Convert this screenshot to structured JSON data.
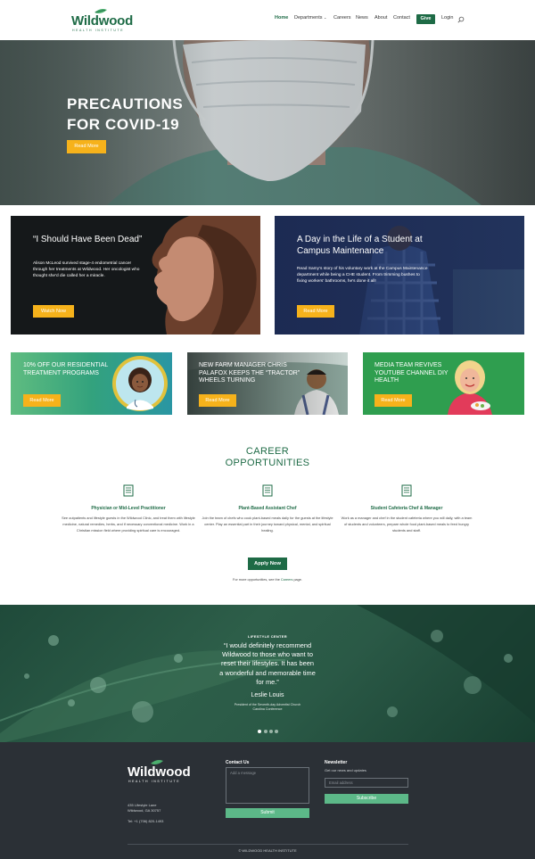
{
  "header": {
    "logo_text": "Wildwood",
    "logo_sub": "HEALTH INSTITUTE",
    "nav": [
      "Home",
      "Departments",
      "Careers",
      "News",
      "About",
      "Contact"
    ],
    "give_label": "Give",
    "login_label": "Login"
  },
  "hero": {
    "title_line1": "PRECAUTIONS",
    "title_line2": "FOR COVID-19",
    "button": "Read More"
  },
  "promo_large": [
    {
      "title": "“I Should Have Been Dead”",
      "text": "Alison McLeod survived stage-4 endometrial cancer through her treatments at Wildwood. Her oncologist who thought she'd die called her a miracle.",
      "button": "Watch Now"
    },
    {
      "title": "A Day in the Life of a Student at Campus Maintenance",
      "text": "Read Samy's story of his voluntary work at the Campus Maintenance department while being a CHE student. From trimming bushes to fixing workers' bathrooms, he's done it all!",
      "button": "Read More"
    }
  ],
  "promo_small": [
    {
      "title": "10% OFF OUR RESIDENTIAL TREATMENT PROGRAMS",
      "button": "Read More"
    },
    {
      "title": "NEW FARM MANAGER CHRIS PALAFOX KEEPS THE “TRACTOR” WHEELS TURNING",
      "button": "Read More"
    },
    {
      "title": "MEDIA TEAM REVIVES YOUTUBE CHANNEL DIY HEALTH",
      "button": "Read More"
    }
  ],
  "careers": {
    "title_line1": "CAREER",
    "title_line2": "OPPORTUNITIES",
    "jobs": [
      {
        "title": "Physician or Mid-Level Practitioner",
        "desc": "See outpatients and lifestyle guests in the Wildwood Clinic, and treat them with lifestyle medicine, natural remedies, herbs, and if necessary conventional medicine. Work in a Christian mission field where providing spiritual care is encouraged."
      },
      {
        "title": "Plant-Based Assistant Chef",
        "desc": "Join the team of chefs who cook plant-based meals daily for the guests at the lifestyle center. Play an essential part in their journey toward physical, mental, and spiritual healing."
      },
      {
        "title": "Student Cafeteria Chef & Manager",
        "desc": "Work as a manager and chef in the student cafeteria where you will daily, with a team of students and volunteers, prepare whole food plant-based meals to feed hungry students and staff."
      }
    ],
    "apply_label": "Apply Now",
    "more_prefix": "For more opportunities, see the ",
    "more_link": "Careers",
    "more_suffix": " page."
  },
  "testimonial": {
    "label": "LIFESTYLE CENTER",
    "quote": "“I would definitely recommend Wildwood to those who want to reset their lifestyles. It has been a wonderful and memorable time for me.”",
    "name": "Leslie Louis",
    "role": "President of the Seventh-day Adventist Church Carolina Conference"
  },
  "footer": {
    "logo_text": "Wildwood",
    "logo_sub": "HEALTH INSTITUTE",
    "address_line1": "435 Lifestyle Lane",
    "address_line2": "Wildwood, GA 30757",
    "phone": "Tel: +1 (706) 820-1493",
    "contact_label": "Contact Us",
    "message_placeholder": "Add a message",
    "submit_label": "Submit",
    "newsletter_label": "Newsletter",
    "newsletter_text": "Get our news and updates",
    "email_placeholder": "Email address",
    "subscribe_label": "Subscribe",
    "copyright": "© WILDWOOD HEALTH INSTITUTE"
  },
  "colors": {
    "brand_green": "#1e6b46",
    "accent_yellow": "#f6b21b",
    "footer_bg": "#2b3036",
    "footer_button": "#5cb888"
  }
}
